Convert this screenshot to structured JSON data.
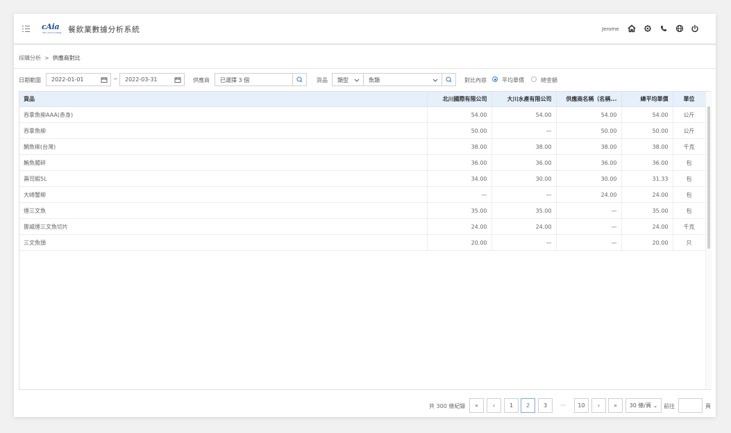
{
  "app": {
    "logo": "cAia",
    "logo_sub": "City of Accounting",
    "title": "餐飲業數據分析系統",
    "user": "Jerome"
  },
  "breadcrumb": {
    "parent": "採購分析",
    "separator": ">",
    "current": "供應商對比"
  },
  "filters": {
    "date_label": "日期範圍",
    "date_start": "2022-01-01",
    "date_tilde": "~",
    "date_end": "2022-03-31",
    "supplier_label": "供應商",
    "supplier_value": "已選擇 3 個",
    "goods_label": "貨品",
    "goods_type": "類型",
    "goods_value": "魚類",
    "compare_label": "對比內容",
    "option_avg": "平均單價",
    "option_total": "總金額"
  },
  "table": {
    "headers": [
      "貨品",
      "北川國際有限公司",
      "大川水產有限公司",
      "供應商名稱（名稱...",
      "總平均單價",
      "單位"
    ],
    "rows": [
      [
        "吞拿魚柳AAA(赤身)",
        "54.00",
        "54.00",
        "54.00",
        "54.00",
        "公斤"
      ],
      [
        "吞拿魚柳",
        "50.00",
        "—",
        "50.00",
        "50.00",
        "公斤"
      ],
      [
        "鯛魚柳(台灣)",
        "38.00",
        "38.00",
        "38.00",
        "38.00",
        "千克"
      ],
      [
        "鮪魚腸碎",
        "36.00",
        "36.00",
        "36.00",
        "36.00",
        "包"
      ],
      [
        "壽司蝦5L",
        "34.00",
        "30.00",
        "30.00",
        "31.33",
        "包"
      ],
      [
        "大崎蟹柳",
        "—",
        "—",
        "24.00",
        "24.00",
        "包"
      ],
      [
        "煙三文魚",
        "35.00",
        "35.00",
        "—",
        "35.00",
        "包"
      ],
      [
        "挪威煙三文魚切片",
        "24.00",
        "24.00",
        "—",
        "24.00",
        "千克"
      ],
      [
        "三文魚頭",
        "20.00",
        "—",
        "—",
        "20.00",
        "只"
      ]
    ]
  },
  "pagination": {
    "total": "共 300 條紀錄",
    "first": "«",
    "prev": "‹",
    "pages": [
      "1",
      "2",
      "3"
    ],
    "ellipsis": "···",
    "last_page": "10",
    "next": "›",
    "last": "»",
    "per_page": "30 條/頁",
    "goto": "前往",
    "unit": "頁"
  },
  "colors": {
    "accent": "#3a7bd5",
    "header_bg": "#e5f0fb",
    "logo": "#1d4f9e"
  }
}
